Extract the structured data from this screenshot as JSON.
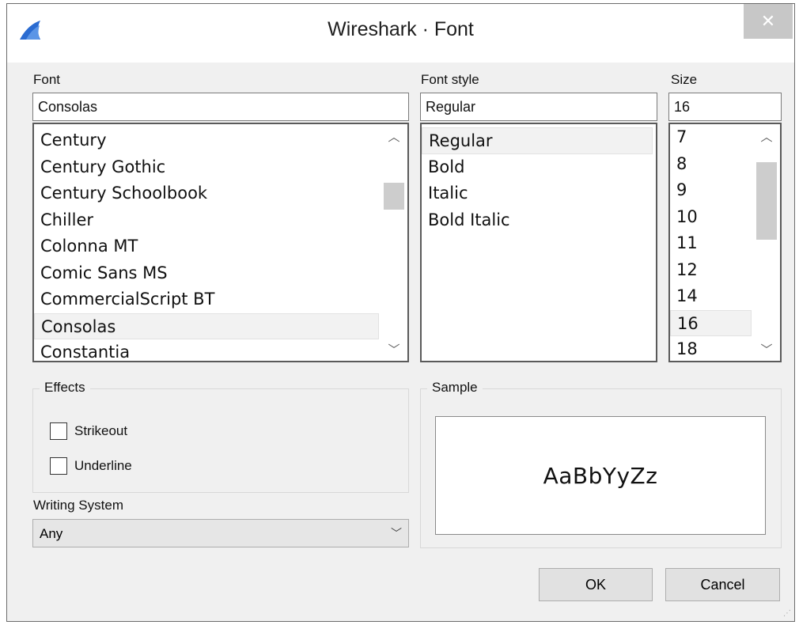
{
  "window": {
    "title": "Wireshark · Font",
    "close_label": "✕",
    "app_icon": "wireshark-fin-icon"
  },
  "font": {
    "label": "Font",
    "value": "Consolas",
    "items": [
      "Century",
      "Century Gothic",
      "Century Schoolbook",
      "Chiller",
      "Colonna MT",
      "Comic Sans MS",
      "CommercialScript BT",
      "Consolas",
      "Constantia"
    ],
    "selected": "Consolas"
  },
  "font_style": {
    "label": "Font style",
    "value": "Regular",
    "items": [
      "Regular",
      "Bold",
      "Italic",
      "Bold Italic"
    ],
    "selected": "Regular"
  },
  "size": {
    "label": "Size",
    "value": "16",
    "items": [
      "7",
      "8",
      "9",
      "10",
      "11",
      "12",
      "14",
      "16",
      "18"
    ],
    "selected": "16"
  },
  "effects": {
    "title": "Effects",
    "strikeout_label": "Strikeout",
    "underline_label": "Underline",
    "strikeout_checked": false,
    "underline_checked": false
  },
  "writing_system": {
    "label": "Writing System",
    "value": "Any"
  },
  "sample": {
    "title": "Sample",
    "text": "AaBbYyZz"
  },
  "buttons": {
    "ok": "OK",
    "cancel": "Cancel"
  },
  "colors": {
    "window_bg": "#f0f0f0",
    "titlebar_bg": "#ffffff",
    "close_bg": "#c7c7c7",
    "icon_blue": "#2a6bd1"
  }
}
